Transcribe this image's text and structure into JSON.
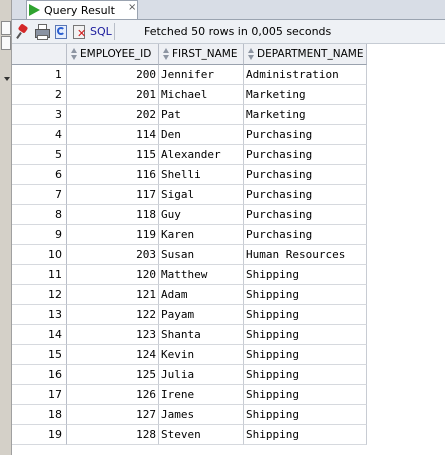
{
  "tab": {
    "title": "Query Result",
    "close": "×"
  },
  "toolbar": {
    "sql_label": "SQL",
    "status": "Fetched 50 rows in 0,005 seconds"
  },
  "table": {
    "columns": [
      "EMPLOYEE_ID",
      "FIRST_NAME",
      "DEPARTMENT_NAME"
    ],
    "rows": [
      {
        "n": "1",
        "id": "200",
        "first": "Jennifer",
        "dept": "Administration"
      },
      {
        "n": "2",
        "id": "201",
        "first": "Michael",
        "dept": "Marketing"
      },
      {
        "n": "3",
        "id": "202",
        "first": "Pat",
        "dept": "Marketing"
      },
      {
        "n": "4",
        "id": "114",
        "first": "Den",
        "dept": "Purchasing"
      },
      {
        "n": "5",
        "id": "115",
        "first": "Alexander",
        "dept": "Purchasing"
      },
      {
        "n": "6",
        "id": "116",
        "first": "Shelli",
        "dept": "Purchasing"
      },
      {
        "n": "7",
        "id": "117",
        "first": "Sigal",
        "dept": "Purchasing"
      },
      {
        "n": "8",
        "id": "118",
        "first": "Guy",
        "dept": "Purchasing"
      },
      {
        "n": "9",
        "id": "119",
        "first": "Karen",
        "dept": "Purchasing"
      },
      {
        "n": "10",
        "id": "203",
        "first": "Susan",
        "dept": "Human Resources"
      },
      {
        "n": "11",
        "id": "120",
        "first": "Matthew",
        "dept": "Shipping"
      },
      {
        "n": "12",
        "id": "121",
        "first": "Adam",
        "dept": "Shipping"
      },
      {
        "n": "13",
        "id": "122",
        "first": "Payam",
        "dept": "Shipping"
      },
      {
        "n": "14",
        "id": "123",
        "first": "Shanta",
        "dept": "Shipping"
      },
      {
        "n": "15",
        "id": "124",
        "first": "Kevin",
        "dept": "Shipping"
      },
      {
        "n": "16",
        "id": "125",
        "first": "Julia",
        "dept": "Shipping"
      },
      {
        "n": "17",
        "id": "126",
        "first": "Irene",
        "dept": "Shipping"
      },
      {
        "n": "18",
        "id": "127",
        "first": "James",
        "dept": "Shipping"
      },
      {
        "n": "19",
        "id": "128",
        "first": "Steven",
        "dept": "Shipping"
      }
    ]
  }
}
